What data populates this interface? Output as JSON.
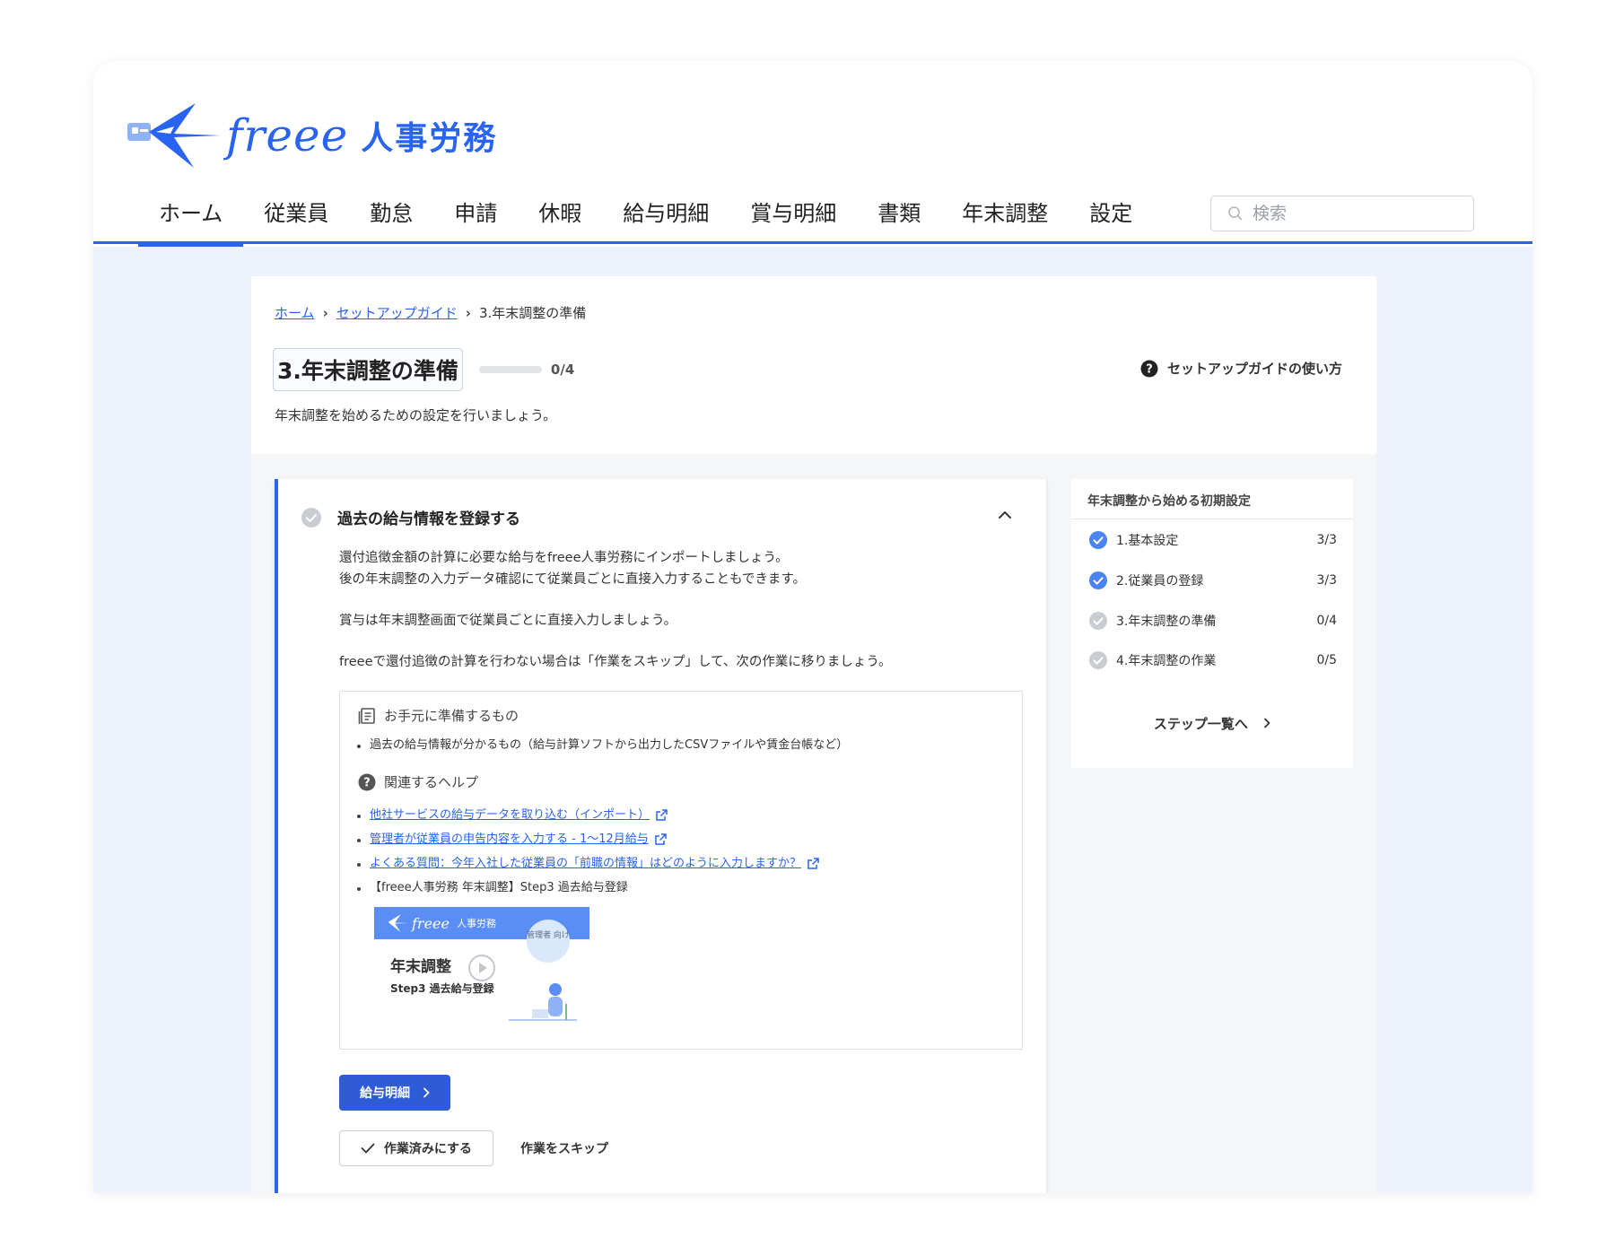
{
  "app": {
    "logo_text": "freee",
    "logo_sub": "人事労務"
  },
  "nav": {
    "items": [
      "ホーム",
      "従業員",
      "勤怠",
      "申請",
      "休暇",
      "給与明細",
      "賞与明細",
      "書類",
      "年末調整",
      "設定"
    ],
    "active_index": 0
  },
  "search": {
    "placeholder": "検索"
  },
  "breadcrumb": [
    "ホーム",
    "セットアップガイド",
    "3.年末調整の準備"
  ],
  "page": {
    "title": "3.年末調整の準備",
    "progress_text": "0/4",
    "progress_fraction": 0,
    "help_link": "セットアップガイドの使い方",
    "description": "年末調整を始めるための設定を行いましょう。"
  },
  "task": {
    "title": "過去の給与情報を登録する",
    "body": [
      "還付追徴金額の計算に必要な給与をfreee人事労務にインポートしましょう。",
      "後の年末調整の入力データ確認にて従業員ごとに直接入力することもできます。",
      "賞与は年末調整画面で従業員ごとに直接入力しましょう。",
      "freeeで還付追徴の計算を行わない場合は「作業をスキップ」して、次の作業に移りましょう。"
    ],
    "prepare_heading": "お手元に準備するもの",
    "prepare_items": [
      "過去の給与情報が分かるもの（給与計算ソフトから出力したCSVファイルや賃金台帳など）"
    ],
    "help_heading": "関連するヘルプ",
    "help_links": [
      "他社サービスの給与データを取り込む（インポート）",
      "管理者が従業員の申告内容を入力する - 1〜12月給与",
      "よくある質問：今年入社した従業員の「前職の情報」はどのように入力しますか？"
    ],
    "video_item": "【freee人事労務 年末調整】Step3 過去給与登録",
    "video": {
      "brand": "freee",
      "brand_sub": "人事労務",
      "badge": "管理者 向け",
      "title": "年末調整",
      "subtitle": "Step3 過去給与登録"
    },
    "primary_button": "給与明細",
    "done_button": "作業済みにする",
    "skip_link": "作業をスキップ"
  },
  "sidebar": {
    "title": "年末調整から始める初期設定",
    "steps": [
      {
        "label": "1.基本設定",
        "count": "3/3",
        "done": true
      },
      {
        "label": "2.従業員の登録",
        "count": "3/3",
        "done": true
      },
      {
        "label": "3.年末調整の準備",
        "count": "0/4",
        "done": false
      },
      {
        "label": "4.年末調整の作業",
        "count": "0/5",
        "done": false
      }
    ],
    "all_steps_link": "ステップ一覧へ"
  },
  "colors": {
    "accent": "#2864f0",
    "primary_button": "#2f5cd6",
    "content_bg": "#edf2fc",
    "check_done": "#4a84f0",
    "check_pending": "#c9ccd1"
  },
  "icons": [
    "brand-bird-icon",
    "search-icon",
    "question-circle-icon",
    "check-circle-icon",
    "chevron-up-icon",
    "document-icon",
    "external-link-icon",
    "play-icon",
    "chevron-right-icon",
    "checkmark-icon"
  ]
}
